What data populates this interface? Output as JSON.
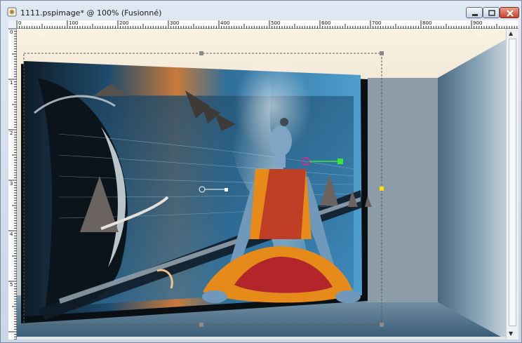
{
  "window": {
    "title": "1111.pspimage* @ 100% (Fusionné)"
  },
  "controls": {
    "minimize_icon": "minimize-icon",
    "maximize_icon": "maximize-icon",
    "close_icon": "close-icon"
  },
  "ruler": {
    "horizontal_labels": [
      "0",
      "100",
      "200",
      "300",
      "400",
      "500",
      "600",
      "700",
      "800",
      "900"
    ],
    "vertical_labels": [
      "0",
      "1",
      "2",
      "3",
      "4",
      "5"
    ]
  },
  "colors": {
    "wall_light": "#f6ead6",
    "room_floor": "#5f7f99",
    "panel_blue": "#2f6f9a",
    "robe_orange": "#e68a1a",
    "robe_red": "#b2262b",
    "handle_green": "#39e639",
    "close_red": "#c7422a"
  }
}
